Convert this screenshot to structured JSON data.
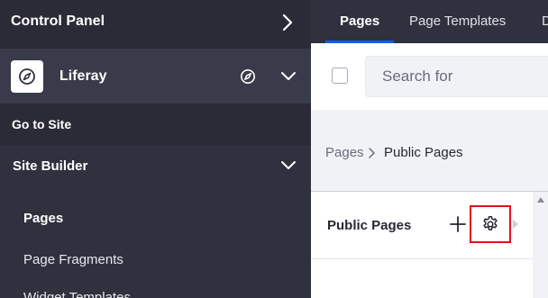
{
  "sidebar": {
    "header_title": "Control Panel",
    "site_name": "Liferay",
    "goto_label": "Go to Site",
    "section_label": "Site Builder",
    "items": [
      {
        "label": "Pages",
        "active": true
      },
      {
        "label": "Page Fragments",
        "active": false
      },
      {
        "label": "Widget Templates",
        "active": false
      }
    ]
  },
  "tabs": [
    {
      "label": "Pages",
      "active": true
    },
    {
      "label": "Page Templates",
      "active": false
    },
    {
      "label": "D",
      "active": false
    }
  ],
  "toolbar": {
    "search_placeholder": "Search for"
  },
  "breadcrumb": {
    "root": "Pages",
    "current": "Public Pages"
  },
  "column": {
    "title": "Public Pages"
  },
  "colors": {
    "sidebar_bg": "#30313f",
    "accent": "#0b5fff",
    "highlight": "#e0101f"
  },
  "icons": {
    "header_action": "chevron-right-icon",
    "site_logo": "compass-icon",
    "site_action": "compass-icon",
    "expand": "chevron-down-icon",
    "add": "plus-icon",
    "settings": "gear-icon"
  }
}
